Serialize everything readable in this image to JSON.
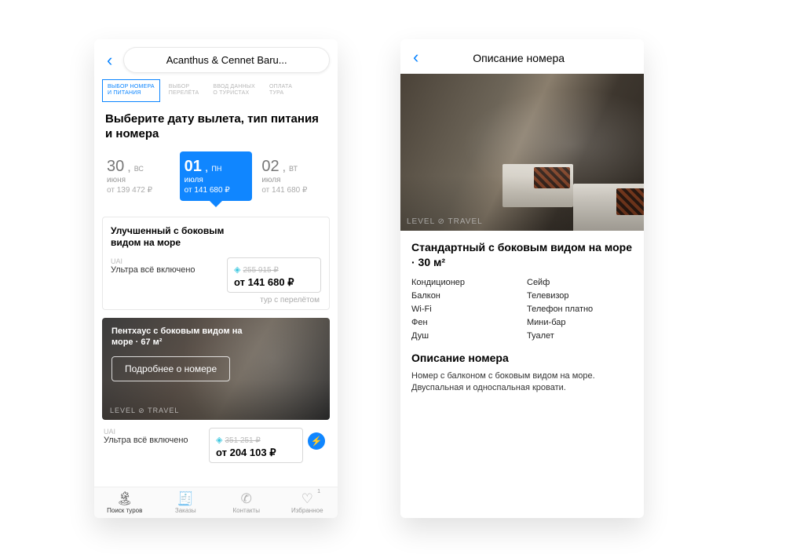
{
  "left": {
    "title_pill": "Acanthus & Cennet Baru...",
    "steps": [
      "ВЫБОР НОМЕРА\nИ ПИТАНИЯ",
      "ВЫБОР\nПЕРЕЛЁТА",
      "ВВОД ДАННЫХ\nО ТУРИСТАХ",
      "ОПЛАТА\nТУРА"
    ],
    "heading": "Выберите дату вылета, тип питания и номера",
    "dates": [
      {
        "num": "30",
        "comma": ",",
        "dow": "ВС",
        "mon": "июня",
        "price": "от 139 472 ₽"
      },
      {
        "num": "01",
        "comma": ",",
        "dow": "ПН",
        "mon": "июля",
        "price": "от 141 680 ₽",
        "active": true
      },
      {
        "num": "02",
        "comma": ",",
        "dow": "ВТ",
        "mon": "июля",
        "price": "от 141 680 ₽"
      }
    ],
    "room1": {
      "name": "Улучшенный с боковым видом на море",
      "meal_code": "UAI",
      "meal_text": "Ультра всё включено",
      "old_price": "255 915 ₽",
      "new_price": "от 141 680 ₽",
      "hint": "тур с перелётом"
    },
    "penthouse": {
      "title": "Пентхаус с боковым видом на море · 67 м²",
      "button": "Подробнее о номере",
      "watermark": "LEVEL ⊘ TRAVEL"
    },
    "room2": {
      "meal_code": "UAI",
      "meal_text": "Ультра всё включено",
      "old_price": "351 251 ₽",
      "new_price": "от 204 103 ₽"
    },
    "tabs": [
      {
        "label": "Поиск туров",
        "icon": "🏝"
      },
      {
        "label": "Заказы",
        "icon": "🧾"
      },
      {
        "label": "Контакты",
        "icon": "✆"
      },
      {
        "label": "Избранное",
        "icon": "♡",
        "badge": "1"
      }
    ]
  },
  "right": {
    "title": "Описание номера",
    "watermark": "LEVEL ⊘ TRAVEL",
    "room_title": "Стандартный с боковым видом на море · 30 м²",
    "amenities_left": [
      "Кондиционер",
      "Балкон",
      "Wi-Fi",
      "Фен",
      "Душ"
    ],
    "amenities_right": [
      "Сейф",
      "Телевизор",
      "Телефон платно",
      "Мини-бар",
      "Туалет"
    ],
    "section": "Описание номера",
    "desc": "Номер с балконом с боковым видом на море. Двуспальная и односпальная кровати."
  }
}
